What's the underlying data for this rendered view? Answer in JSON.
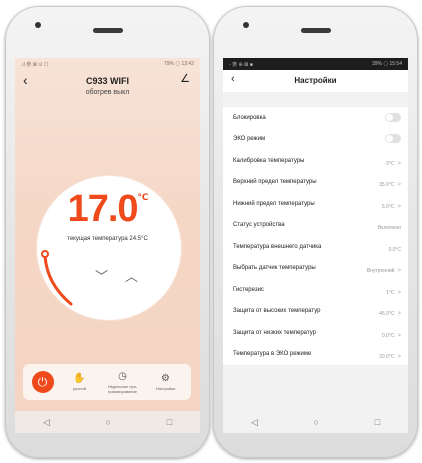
{
  "left_screen": {
    "status_left": ".ıl 奈 ⊠ ⊙ ☐",
    "status_right": "79% ▢ 13:42",
    "device_name": "C933 WIFI",
    "mode_status": "обогрев выкл",
    "set_temperature": "17.0",
    "temperature_unit": "℃",
    "current_temperature_text": "текущая температура 24.5°C",
    "toolbar": {
      "manual_label": "ручной",
      "weekly_label": "Недельное про-граммирование",
      "settings_label": "Настройки"
    },
    "icons": {
      "back": "‹",
      "edit": "∠",
      "chevron_down": "﹀",
      "chevron_up": "︿"
    }
  },
  "right_screen": {
    "status_left": "▫ 奈 ⊕ ⊠ ■",
    "status_right": "39% ▢ 15:54",
    "title": "Настройки",
    "settings": [
      {
        "label": "Блокировка",
        "type": "toggle"
      },
      {
        "label": "ЭКО режим",
        "type": "toggle"
      },
      {
        "label": "Калибровка температуры",
        "value": "-3°C",
        "arrow": true
      },
      {
        "label": "Верхний предел температуры",
        "value": "35.0°C",
        "arrow": true
      },
      {
        "label": "Нижний предел температуры",
        "value": "5.0°C",
        "arrow": true
      },
      {
        "label": "Статус устройства",
        "value": "Включено",
        "arrow": false
      },
      {
        "label": "Температура внешнего датчика",
        "value": "0.0°C",
        "arrow": false
      },
      {
        "label": "Выбрать датчик температуры",
        "value": "Внутренний",
        "arrow": true
      },
      {
        "label": "Гистерезис",
        "value": "1°C",
        "arrow": true
      },
      {
        "label": "Защита от высоких температур",
        "value": "45.0°C",
        "arrow": true
      },
      {
        "label": "Защита от низких температур",
        "value": "0.0°C",
        "arrow": true
      },
      {
        "label": "Температура в ЭКО режиме",
        "value": "20.0°C",
        "arrow": true
      }
    ]
  },
  "nav": {
    "back": "◁",
    "home": "○",
    "recents": "□"
  },
  "colors": {
    "accent": "#f04a1c",
    "peach_bg": "#f5d7c6",
    "toggle_off": "#e0e0e0"
  }
}
